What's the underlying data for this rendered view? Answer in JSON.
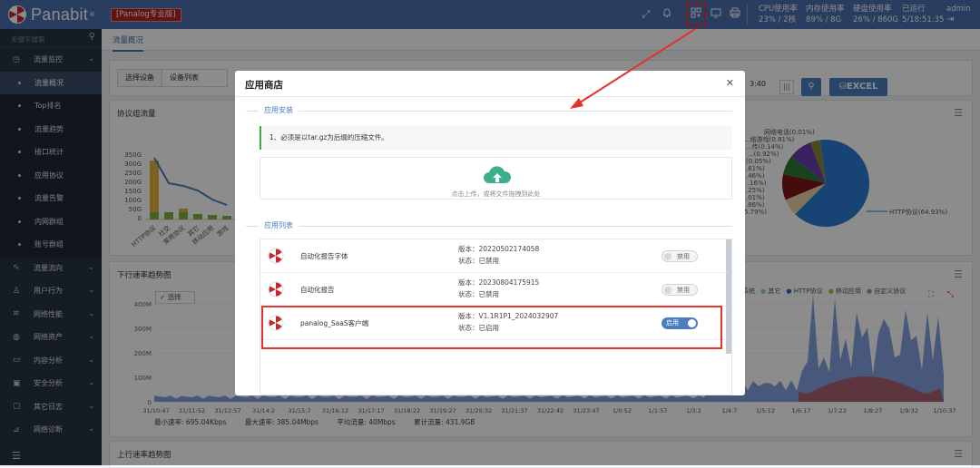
{
  "app": {
    "brand": "Panabit",
    "edition": "[Panalog专业版]"
  },
  "top_stats": {
    "cpu_label": "CPU使用率",
    "cpu_value": "23% / 2核",
    "mem_label": "内存使用率",
    "mem_value": "89% / 8G",
    "disk_label": "硬盘使用率",
    "disk_value": "26% / 860G",
    "uptime_label": "已运行",
    "uptime_value": "5/18:51:35",
    "user": "admin"
  },
  "sidebar": {
    "search_placeholder": "关键字搜索",
    "items": [
      {
        "label": "流量监控",
        "icon": "gauge-icon",
        "expanded": true
      },
      {
        "label": "流量概况",
        "sub": true,
        "active": true
      },
      {
        "label": "Top排名",
        "sub": true
      },
      {
        "label": "流量趋势",
        "sub": true
      },
      {
        "label": "接口统计",
        "sub": true
      },
      {
        "label": "应用协议",
        "sub": true
      },
      {
        "label": "流量告警",
        "sub": true
      },
      {
        "label": "内网群组",
        "sub": true
      },
      {
        "label": "账号群组",
        "sub": true
      },
      {
        "label": "流量流向",
        "icon": "pulse-icon"
      },
      {
        "label": "用户行为",
        "icon": "user-icon"
      },
      {
        "label": "网络性能",
        "icon": "wifi-icon"
      },
      {
        "label": "网络资产",
        "icon": "globe-icon"
      },
      {
        "label": "内容分析",
        "icon": "book-icon"
      },
      {
        "label": "安全分析",
        "icon": "shield-icon"
      },
      {
        "label": "其它日志",
        "icon": "log-icon"
      },
      {
        "label": "网络诊断",
        "icon": "signal-icon"
      }
    ]
  },
  "tab": {
    "active": "流量概况"
  },
  "filter": {
    "select_device_label": "选择设备",
    "device_value": "设备列表",
    "time_tail": "3:40",
    "excel_label": "EXCEL"
  },
  "panels": {
    "group_traffic_title": "协议组流量",
    "down_title": "下行速率趋势图",
    "up_title": "上行速率趋势图",
    "select_label": "选择"
  },
  "bar_chart": {
    "y_ticks": [
      "350G",
      "300G",
      "250G",
      "200G",
      "150G",
      "100G",
      "50G",
      "0"
    ],
    "x_labels": [
      "HTTP协议",
      "社交",
      "常用协议",
      "其它",
      "移动应用",
      "游戏"
    ]
  },
  "pie_labels": [
    "网络电话(0.01%)",
    "...络游戏(0.81%)",
    "...传(0.14%)",
    "...(0.92%)",
    "(0.05%)",
    ".61%)",
    ".46%)",
    ".16%)",
    ".25%)",
    ".01%)",
    ".86%)",
    "5.79%)",
    "HTTP协议(64.93%)"
  ],
  "legend": [
    "系统",
    "其它",
    "HTTP协议",
    "移动应用",
    "自定义协议"
  ],
  "line_chart": {
    "y_ticks": [
      "400M",
      "300M",
      "200M",
      "100M",
      "0"
    ],
    "x_labels": [
      "31/10:47",
      "31/11:52",
      "31/12:57",
      "31/14:2",
      "31/15:7",
      "31/16:12",
      "31/17:17",
      "31/18:22",
      "31/19:27",
      "31/20:32",
      "31/21:37",
      "31/22:42",
      "31/23:47",
      "1/0:52",
      "1/1:57",
      "1/3:2",
      "1/4:7",
      "1/5:12",
      "1/6:17",
      "1/7:22",
      "1/8:27",
      "1/9:32",
      "1/10:37"
    ],
    "stats": {
      "min": "最小速率: 695.04Kbps",
      "max": "最大速率: 385.04Mbps",
      "avg": "平均流量: 40Mbps",
      "total": "累计流量: 431.9GB"
    }
  },
  "modal": {
    "title": "应用商店",
    "install_section": "应用安装",
    "note": "1、必须是以tar.gz为后缀的压缩文件。",
    "upload_hint": "点击上传，或将文件拖拽到此处",
    "list_section": "应用列表",
    "apps": [
      {
        "name": "自动化报告字体",
        "version": "版本：20220502174058",
        "status": "状态：已禁用",
        "toggle": "禁用",
        "enabled": false
      },
      {
        "name": "自动化报告",
        "version": "版本：20230804175915",
        "status": "状态：已禁用",
        "toggle": "禁用",
        "enabled": false
      },
      {
        "name": "panalog_SaaS客户端",
        "version": "版本：V1.1R1P1_2024032907",
        "status": "状态：已启用",
        "toggle": "启用",
        "enabled": true
      }
    ]
  },
  "colors": {
    "header": "#4a6fad",
    "sidebar": "#283346",
    "accent": "#4a7ec2",
    "highlight": "#e5322d",
    "enabled_toggle": "#4a7ec2"
  }
}
